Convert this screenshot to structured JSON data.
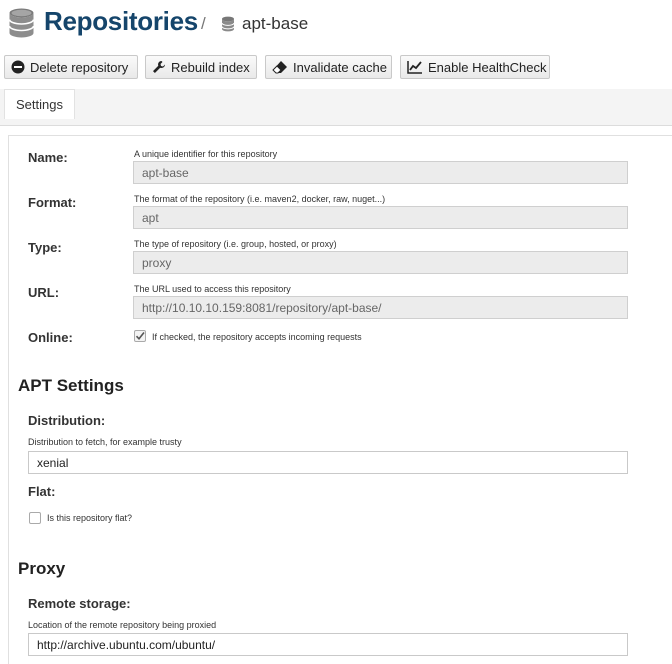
{
  "breadcrumb": {
    "title": "Repositories",
    "separator": "/",
    "current": "apt-base"
  },
  "toolbar": {
    "delete_label": "Delete repository",
    "rebuild_label": "Rebuild index",
    "invalidate_label": "Invalidate cache",
    "healthcheck_label": "Enable HealthCheck"
  },
  "tabs": {
    "settings": "Settings"
  },
  "form": {
    "name": {
      "label": "Name:",
      "help": "A unique identifier for this repository",
      "value": "apt-base"
    },
    "format": {
      "label": "Format:",
      "help": "The format of the repository (i.e. maven2, docker, raw, nuget...)",
      "value": "apt"
    },
    "type": {
      "label": "Type:",
      "help": "The type of repository (i.e. group, hosted, or proxy)",
      "value": "proxy"
    },
    "url": {
      "label": "URL:",
      "help": "The URL used to access this repository",
      "value": "http://10.10.10.159:8081/repository/apt-base/"
    },
    "online": {
      "label": "Online:",
      "help": "If checked, the repository accepts incoming requests",
      "checked": true
    }
  },
  "apt": {
    "heading": "APT Settings",
    "distribution": {
      "label": "Distribution:",
      "help": "Distribution to fetch, for example trusty",
      "value": "xenial"
    },
    "flat": {
      "label": "Flat:",
      "help": "Is this repository flat?",
      "checked": false
    }
  },
  "proxy": {
    "heading": "Proxy",
    "remote": {
      "label": "Remote storage:",
      "help": "Location of the remote repository being proxied",
      "value": "http://archive.ubuntu.com/ubuntu/"
    }
  },
  "colors": {
    "title": "#15456b",
    "readonly_field_bg": "#ececec",
    "tab_bar_bg": "#f4f4f4"
  },
  "icons": [
    "database-icon",
    "small-database-icon",
    "minus-circle-icon",
    "wrench-icon",
    "eraser-icon",
    "line-chart-icon",
    "checkmark-icon"
  ]
}
